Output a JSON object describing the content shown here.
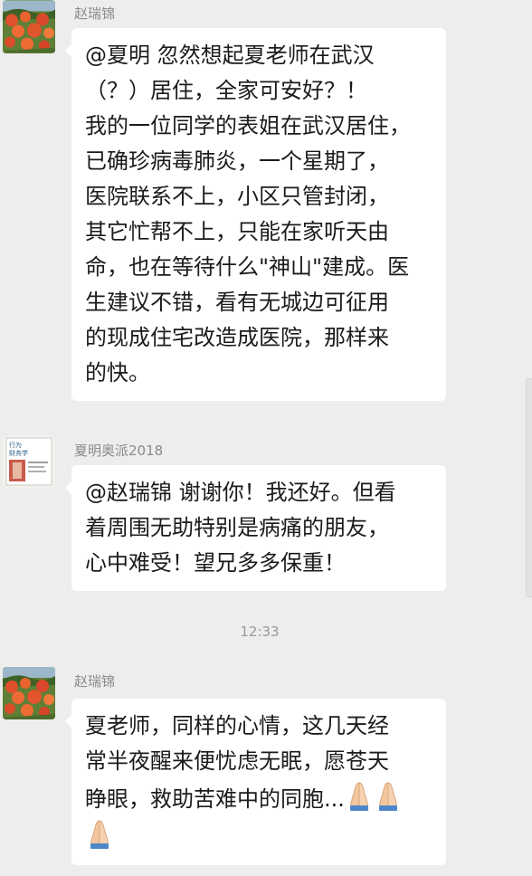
{
  "messages": [
    {
      "sender": "赵瑞锦",
      "avatar_icon": "persimmon-tree-avatar",
      "lines": [
        "@夏明  忽然想起夏老师在武汉",
        "（？）居住，全家可安好？！",
        "我的一位同学的表姐在武汉居住，",
        "已确珍病毒肺炎，一个星期了，",
        "医院联系不上，小区只管封闭，",
        "其它忙帮不上，只能在家听天由",
        "命，也在等待什么\"神山\"建成。医",
        "生建议不错，看有无城边可征用",
        "的现成住宅改造成医院，那样来",
        "的快。"
      ]
    },
    {
      "sender": "夏明奥派2018",
      "avatar_icon": "book-cover-avatar",
      "avatar_text": "行为 财务学",
      "lines": [
        "@赵瑞锦  谢谢你！我还好。但看",
        "着周围无助特别是病痛的朋友，",
        "心中难受！望兄多多保重！"
      ]
    },
    {
      "sender": "赵瑞锦",
      "avatar_icon": "persimmon-tree-avatar",
      "lines": [
        "夏老师，同样的心情，这几天经",
        "常半夜醒来便忧虑无眠，愿苍天",
        "睁眼，救助苦难中的同胞..."
      ],
      "emoji": [
        "folded-hands-emoji",
        "folded-hands-emoji",
        "folded-hands-emoji"
      ]
    }
  ],
  "timestamp": "12:33",
  "colors": {
    "background": "#ededed",
    "bubble": "#ffffff",
    "sender_name": "#8a8a8a"
  }
}
